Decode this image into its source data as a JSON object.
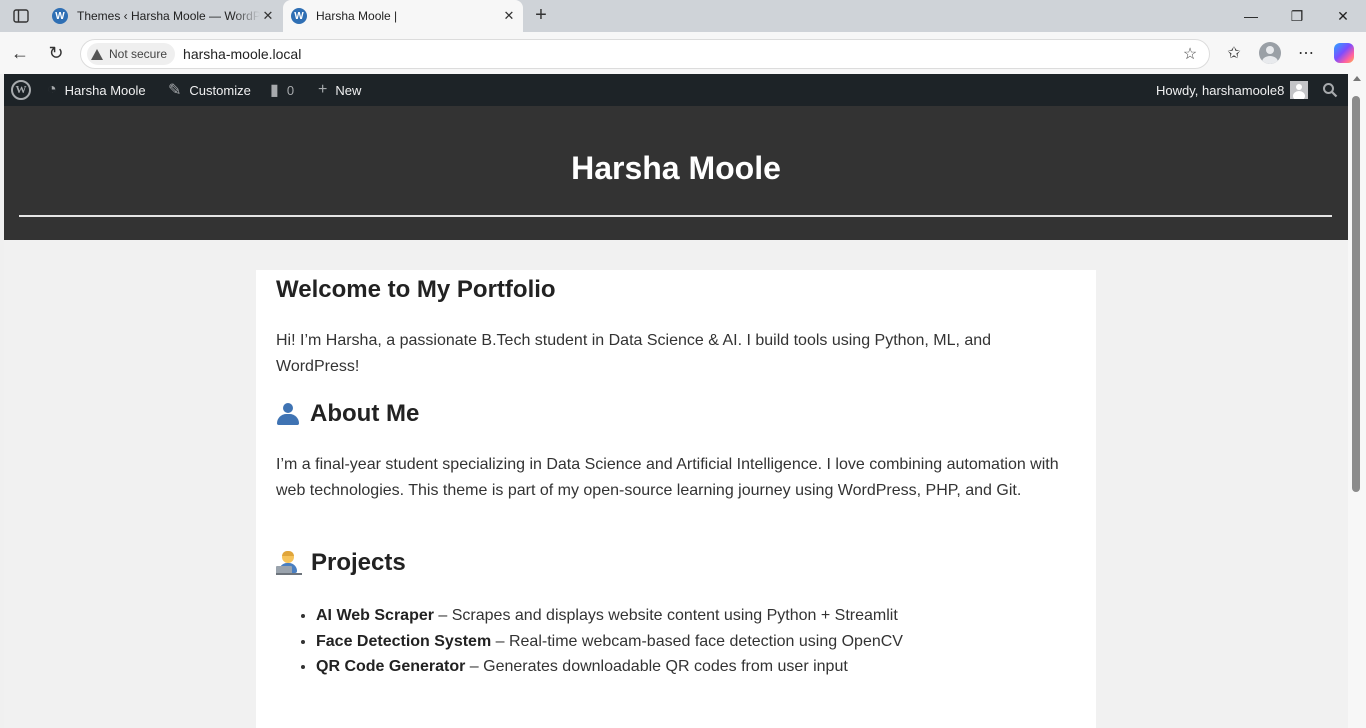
{
  "browser": {
    "tabs": [
      {
        "title": "Themes ‹ Harsha Moole — WordPress",
        "active": false
      },
      {
        "title": "Harsha Moole |",
        "active": true
      }
    ],
    "address": {
      "security_label": "Not secure",
      "url": "harsha-moole.local"
    }
  },
  "adminbar": {
    "site_name": "Harsha Moole",
    "customize": "Customize",
    "comments_count": "0",
    "new": "New",
    "howdy": "Howdy, harshamoole8"
  },
  "site": {
    "title": "Harsha Moole"
  },
  "content": {
    "heading": "Welcome to My Portfolio",
    "intro": "Hi! I’m Harsha, a passionate B.Tech student in Data Science & AI. I build tools using Python, ML, and WordPress!",
    "about_heading": "About Me",
    "about_text": "I’m a final-year student specializing in Data Science and Artificial Intelligence. I love combining automation with web technologies. This theme is part of my open-source learning journey using WordPress, PHP, and Git.",
    "projects_heading": "Projects",
    "projects": [
      {
        "name": "AI Web Scraper",
        "desc": " – Scrapes and displays website content using Python + Streamlit"
      },
      {
        "name": "Face Detection System",
        "desc": " – Real-time webcam-based face detection using OpenCV"
      },
      {
        "name": "QR Code Generator",
        "desc": " – Generates downloadable QR codes from user input"
      }
    ]
  },
  "colors": {
    "admin_bar": "#1d2327",
    "header_bg": "#333333",
    "page_bg": "#f1f1f1",
    "wp_blue": "#2f6fb4"
  },
  "icons": [
    "sidebar-toggle-icon",
    "wordpress-icon",
    "close-icon",
    "plus-icon",
    "minimize-icon",
    "restore-icon",
    "back-icon",
    "reload-icon",
    "warning-icon",
    "star-icon",
    "favorites-icon",
    "profile-icon",
    "more-icon",
    "copilot-icon",
    "dashboard-icon",
    "brush-icon",
    "comment-icon",
    "search-icon",
    "person-emoji",
    "technologist-emoji"
  ]
}
